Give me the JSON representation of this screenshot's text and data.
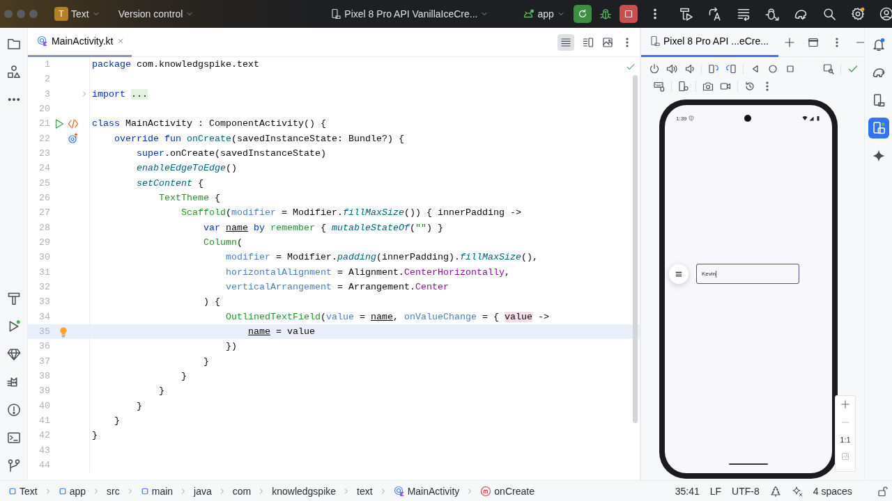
{
  "title_bar": {
    "project_initial": "T",
    "project": "Text",
    "vcs": "Version control",
    "device": "Pixel 8 Pro API VanillaIceCre...",
    "run_config": "app"
  },
  "editor": {
    "tabs": [
      {
        "label": "MainActivity.kt",
        "selected": true
      }
    ],
    "lines": [
      {
        "number": "1",
        "current": false,
        "tokens": [
          {
            "text": "package",
            "kind": "keyword"
          },
          {
            "text": " com.knowledgspike.text",
            "kind": "plain"
          }
        ]
      },
      {
        "number": "2",
        "current": false
      },
      {
        "number": "3",
        "current": false,
        "gutter": [
          {
            "kind": "fold"
          }
        ],
        "tokens": [
          {
            "text": "import ",
            "kind": "keyword"
          },
          {
            "text": "...",
            "kind": "folded"
          }
        ]
      },
      {
        "number": "20",
        "current": false
      },
      {
        "number": "21",
        "current": false,
        "gutter": [
          {
            "kind": "run"
          },
          {
            "kind": "compose"
          }
        ],
        "tokens": [
          {
            "text": "class",
            "kind": "keyword"
          },
          {
            "text": " MainActivity : ComponentActivity() {",
            "kind": "plain"
          }
        ]
      },
      {
        "number": "22",
        "current": false,
        "gutter": [
          {
            "kind": "override"
          }
        ],
        "tokens": [
          {
            "text": "    override fun ",
            "kind": "keyword"
          },
          {
            "text": "onCreate",
            "kind": "declaration"
          },
          {
            "text": "(savedInstanceState: Bundle?) {",
            "kind": "plain"
          }
        ]
      },
      {
        "number": "23",
        "current": false,
        "tokens": [
          {
            "text": "        super",
            "kind": "keyword"
          },
          {
            "text": ".onCreate(savedInstanceState)",
            "kind": "plain"
          }
        ]
      },
      {
        "number": "24",
        "current": false,
        "tokens": [
          {
            "text": "        enableEdgeToEdge",
            "kind": "call"
          },
          {
            "text": "()",
            "kind": "plain"
          }
        ]
      },
      {
        "number": "25",
        "current": false,
        "tokens": [
          {
            "text": "        setContent",
            "kind": "call"
          },
          {
            "text": " {",
            "kind": "plain"
          }
        ]
      },
      {
        "number": "26",
        "current": false,
        "tokens": [
          {
            "text": "            TextTheme",
            "kind": "composable"
          },
          {
            "text": " {",
            "kind": "plain"
          }
        ]
      },
      {
        "number": "27",
        "current": false,
        "tokens": [
          {
            "text": "                Scaffold",
            "kind": "composable"
          },
          {
            "text": "(",
            "kind": "plain"
          },
          {
            "text": "modifier",
            "kind": "argument"
          },
          {
            "text": " = Modifier.",
            "kind": "plain"
          },
          {
            "text": "fillMaxSize",
            "kind": "call"
          },
          {
            "text": "()) { innerPadding ->",
            "kind": "plain"
          }
        ]
      },
      {
        "number": "28",
        "current": false,
        "tokens": [
          {
            "text": "                    var ",
            "kind": "keyword"
          },
          {
            "text": "name",
            "kind": "variable"
          },
          {
            "text": " by ",
            "kind": "keyword"
          },
          {
            "text": "remember",
            "kind": "composable"
          },
          {
            "text": " { ",
            "kind": "plain"
          },
          {
            "text": "mutableStateOf",
            "kind": "call"
          },
          {
            "text": "(",
            "kind": "plain"
          },
          {
            "text": "\"\"",
            "kind": "string"
          },
          {
            "text": ") }",
            "kind": "plain"
          }
        ]
      },
      {
        "number": "29",
        "current": false,
        "tokens": [
          {
            "text": "                    Column",
            "kind": "composable"
          },
          {
            "text": "(",
            "kind": "plain"
          }
        ]
      },
      {
        "number": "30",
        "current": false,
        "tokens": [
          {
            "text": "                        modifier",
            "kind": "argument"
          },
          {
            "text": " = Modifier.",
            "kind": "plain"
          },
          {
            "text": "padding",
            "kind": "call"
          },
          {
            "text": "(innerPadding).",
            "kind": "plain"
          },
          {
            "text": "fillMaxSize",
            "kind": "call"
          },
          {
            "text": "(),",
            "kind": "plain"
          }
        ]
      },
      {
        "number": "31",
        "current": false,
        "tokens": [
          {
            "text": "                        horizontalAlignment",
            "kind": "argument"
          },
          {
            "text": " = Alignment.",
            "kind": "plain"
          },
          {
            "text": "CenterHorizontally",
            "kind": "constant"
          },
          {
            "text": ",",
            "kind": "plain"
          }
        ]
      },
      {
        "number": "32",
        "current": false,
        "tokens": [
          {
            "text": "                        verticalArrangement",
            "kind": "argument"
          },
          {
            "text": " = Arrangement.",
            "kind": "plain"
          },
          {
            "text": "Center",
            "kind": "constant"
          }
        ]
      },
      {
        "number": "33",
        "current": false,
        "tokens": [
          {
            "text": "                    ) {",
            "kind": "plain"
          }
        ]
      },
      {
        "number": "34",
        "current": false,
        "tokens": [
          {
            "text": "                        OutlinedTextField",
            "kind": "composable"
          },
          {
            "text": "(",
            "kind": "plain"
          },
          {
            "text": "value",
            "kind": "argument"
          },
          {
            "text": " = ",
            "kind": "plain"
          },
          {
            "text": "name",
            "kind": "variable"
          },
          {
            "text": ", ",
            "kind": "plain"
          },
          {
            "text": "onValueChange",
            "kind": "argument"
          },
          {
            "text": " = { ",
            "kind": "plain"
          },
          {
            "text": "value",
            "kind": "parameter"
          },
          {
            "text": " ->",
            "kind": "plain"
          }
        ]
      },
      {
        "number": "35",
        "current": true,
        "gutter": [
          {
            "kind": "bulb"
          }
        ],
        "tokens": [
          {
            "text": "                            name",
            "kind": "variable"
          },
          {
            "text": " = ",
            "kind": "plain"
          },
          {
            "text": "value",
            "kind": "usage"
          }
        ]
      },
      {
        "number": "36",
        "current": false,
        "tokens": [
          {
            "text": "                        })",
            "kind": "plain"
          }
        ]
      },
      {
        "number": "37",
        "current": false,
        "tokens": [
          {
            "text": "                    }",
            "kind": "plain"
          }
        ]
      },
      {
        "number": "38",
        "current": false,
        "tokens": [
          {
            "text": "                }",
            "kind": "plain"
          }
        ]
      },
      {
        "number": "39",
        "current": false,
        "tokens": [
          {
            "text": "            }",
            "kind": "plain"
          }
        ]
      },
      {
        "number": "40",
        "current": false,
        "tokens": [
          {
            "text": "        }",
            "kind": "plain"
          }
        ]
      },
      {
        "number": "41",
        "current": false,
        "tokens": [
          {
            "text": "    }",
            "kind": "plain"
          }
        ]
      },
      {
        "number": "42",
        "current": false,
        "tokens": [
          {
            "text": "}",
            "kind": "plain"
          }
        ]
      },
      {
        "number": "43",
        "current": false
      },
      {
        "number": "44",
        "current": false
      }
    ]
  },
  "emulator": {
    "tabs": [
      {
        "label": "Pixel 8 Pro API ...eCre...",
        "selected": true
      }
    ],
    "phone": {
      "time": "1:39",
      "field_value": "Kevin"
    },
    "zoom_reset": "1:1"
  },
  "right_toolbar": [
    {
      "kind": "notifications",
      "selected": false
    },
    {
      "kind": "gradle",
      "selected": false
    },
    {
      "kind": "devices",
      "selected": false
    },
    {
      "kind": "device-manager",
      "selected": true
    },
    {
      "kind": "assistant",
      "selected": false
    }
  ],
  "status_bar": {
    "breadcrumbs": [
      {
        "label": "Text",
        "kind": "module"
      },
      {
        "label": "app",
        "kind": "module"
      },
      {
        "label": "src",
        "kind": "folder"
      },
      {
        "label": "main",
        "kind": "module"
      },
      {
        "label": "java",
        "kind": "folder"
      },
      {
        "label": "com",
        "kind": "folder"
      },
      {
        "label": "knowledgspike",
        "kind": "folder"
      },
      {
        "label": "text",
        "kind": "folder"
      },
      {
        "label": "MainActivity",
        "kind": "class"
      },
      {
        "label": "onCreate",
        "kind": "method"
      }
    ],
    "position": "35:41",
    "line_separator": "LF",
    "encoding": "UTF-8",
    "indent": "4 spaces"
  }
}
